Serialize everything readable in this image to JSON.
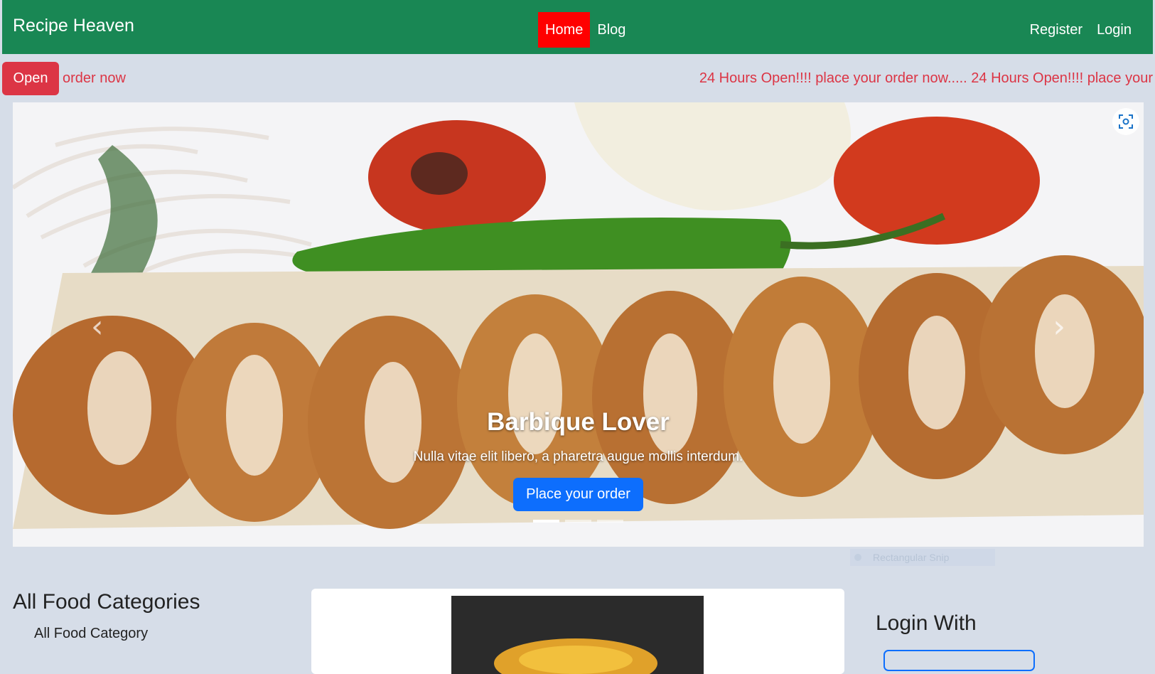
{
  "navbar": {
    "brand": "Recipe Heaven",
    "links": [
      {
        "label": "Home",
        "active": true
      },
      {
        "label": "Blog",
        "active": false
      }
    ],
    "auth": [
      "Register",
      "Login"
    ],
    "bg_color": "#198754",
    "active_color": "#ff0000"
  },
  "ticker": {
    "badge": "Open",
    "left_text": "order now",
    "marquee": "24 Hours Open!!!! place your order now..... 24 Hours Open!!!! place your"
  },
  "carousel": {
    "title": "Barbique Lover",
    "text": "Nulla vitae elit libero, a pharetra augue mollis interdum.",
    "button": "Place your order",
    "slides": 3,
    "active_slide": 1
  },
  "snip_tooltip": "Rectangular Snip",
  "categories": {
    "title": "All Food Categories",
    "items": [
      "All Food Category"
    ]
  },
  "login": {
    "title": "Login With"
  },
  "icons": {
    "prev": "chevron-left-icon",
    "next": "chevron-right-icon",
    "snip": "screenshot-icon"
  }
}
